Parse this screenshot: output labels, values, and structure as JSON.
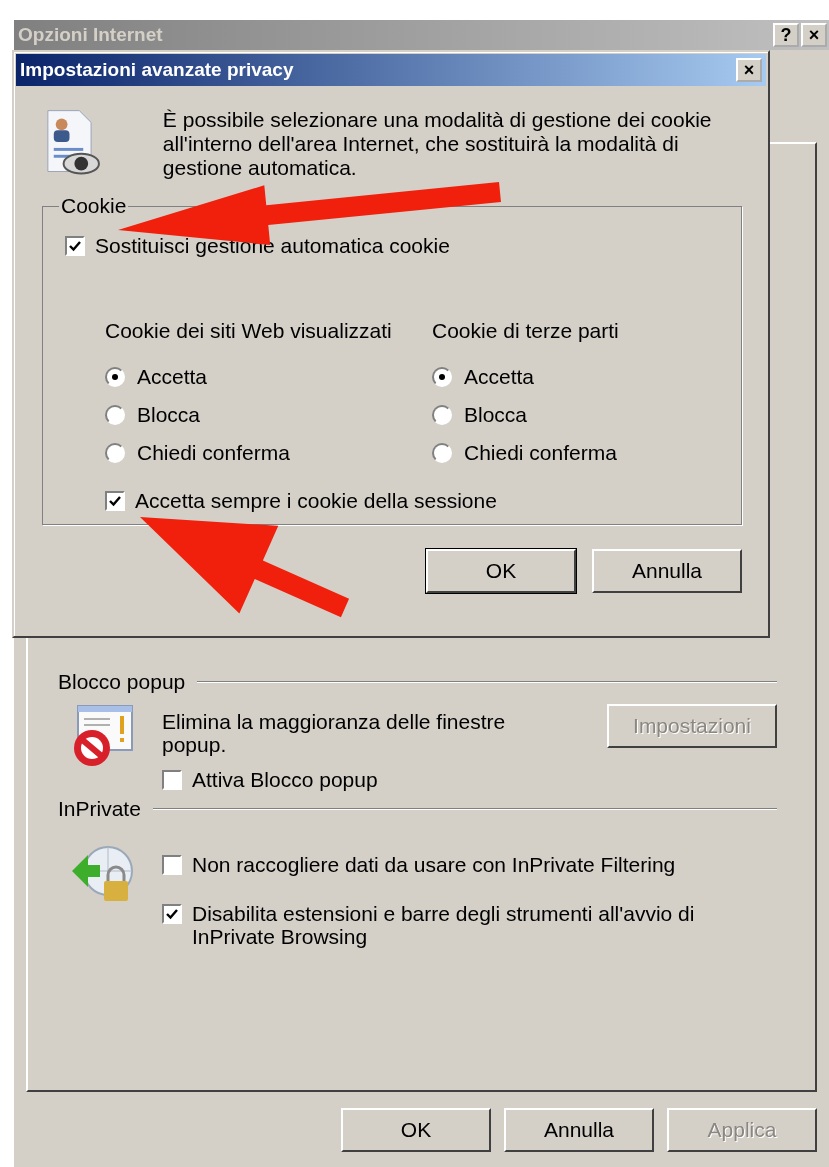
{
  "window": {
    "title": "Opzioni Internet",
    "help_button": "?",
    "close_button": "×"
  },
  "privacy_dialog": {
    "title": "Impostazioni avanzate privacy",
    "close_button": "×",
    "description": "È possibile selezionare una modalità di gestione dei cookie all'interno dell'area Internet, che sostituirà la modalità di gestione automatica.",
    "cookie_group": {
      "title": "Cookie",
      "override": {
        "label": "Sostituisci gestione automatica cookie",
        "checked": true
      },
      "columns": [
        {
          "heading": "Cookie dei siti Web visualizzati",
          "options": [
            {
              "label": "Accetta",
              "selected": true
            },
            {
              "label": "Blocca",
              "selected": false
            },
            {
              "label": "Chiedi conferma",
              "selected": false
            }
          ]
        },
        {
          "heading": "Cookie di terze parti",
          "options": [
            {
              "label": "Accetta",
              "selected": true
            },
            {
              "label": "Blocca",
              "selected": false
            },
            {
              "label": "Chiedi conferma",
              "selected": false
            }
          ]
        }
      ],
      "session": {
        "label": "Accetta sempre i cookie della sessione",
        "checked": true
      }
    },
    "buttons": [
      {
        "label": "OK",
        "default": true
      },
      {
        "label": "Annulla",
        "default": false
      }
    ]
  },
  "popup_blocker": {
    "heading": "Blocco popup",
    "description": "Elimina la maggioranza delle finestre popup.",
    "settings_button": {
      "label": "Impostazioni",
      "disabled": true
    },
    "enable": {
      "label": "Attiva Blocco popup",
      "checked": false
    }
  },
  "inprivate": {
    "heading": "InPrivate",
    "options": [
      {
        "label": "Non raccogliere dati da usare con InPrivate Filtering",
        "checked": false
      },
      {
        "label": "Disabilita estensioni e barre degli strumenti all'avvio di InPrivate Browsing",
        "checked": true
      }
    ]
  },
  "buttons": [
    {
      "label": "OK",
      "disabled": false
    },
    {
      "label": "Annulla",
      "disabled": false
    },
    {
      "label": "Applica",
      "disabled": true
    }
  ]
}
